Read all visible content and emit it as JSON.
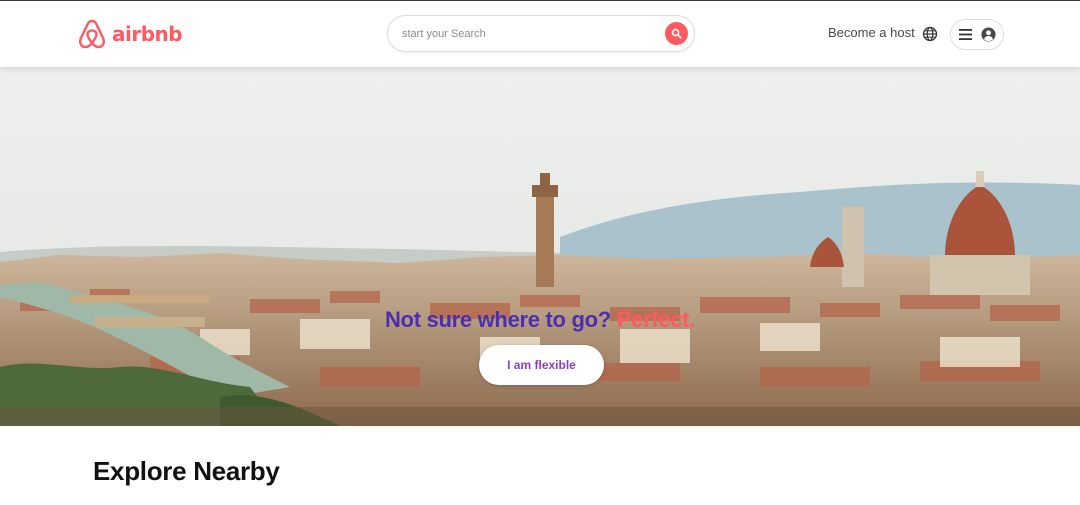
{
  "header": {
    "brand": "airbnb",
    "logo_icon": "airbnb-belo-icon",
    "search": {
      "placeholder": "start your Search",
      "value": "",
      "button_icon": "search-icon"
    },
    "become_host": "Become a host",
    "globe_icon": "globe-icon",
    "menu_icon": "hamburger-menu-icon",
    "user_icon": "user-avatar-icon"
  },
  "hero": {
    "title_part1": "Not sure where to go?",
    "title_part2": "Perfect.",
    "button": "I am flexible",
    "image_description": "panoramic city view with cathedral dome and river bridge"
  },
  "explore": {
    "title": "Explore Nearby"
  },
  "colors": {
    "brand": "#ff5a5f",
    "headline": "#4a2fb3",
    "button_text": "#8b3dc9"
  }
}
